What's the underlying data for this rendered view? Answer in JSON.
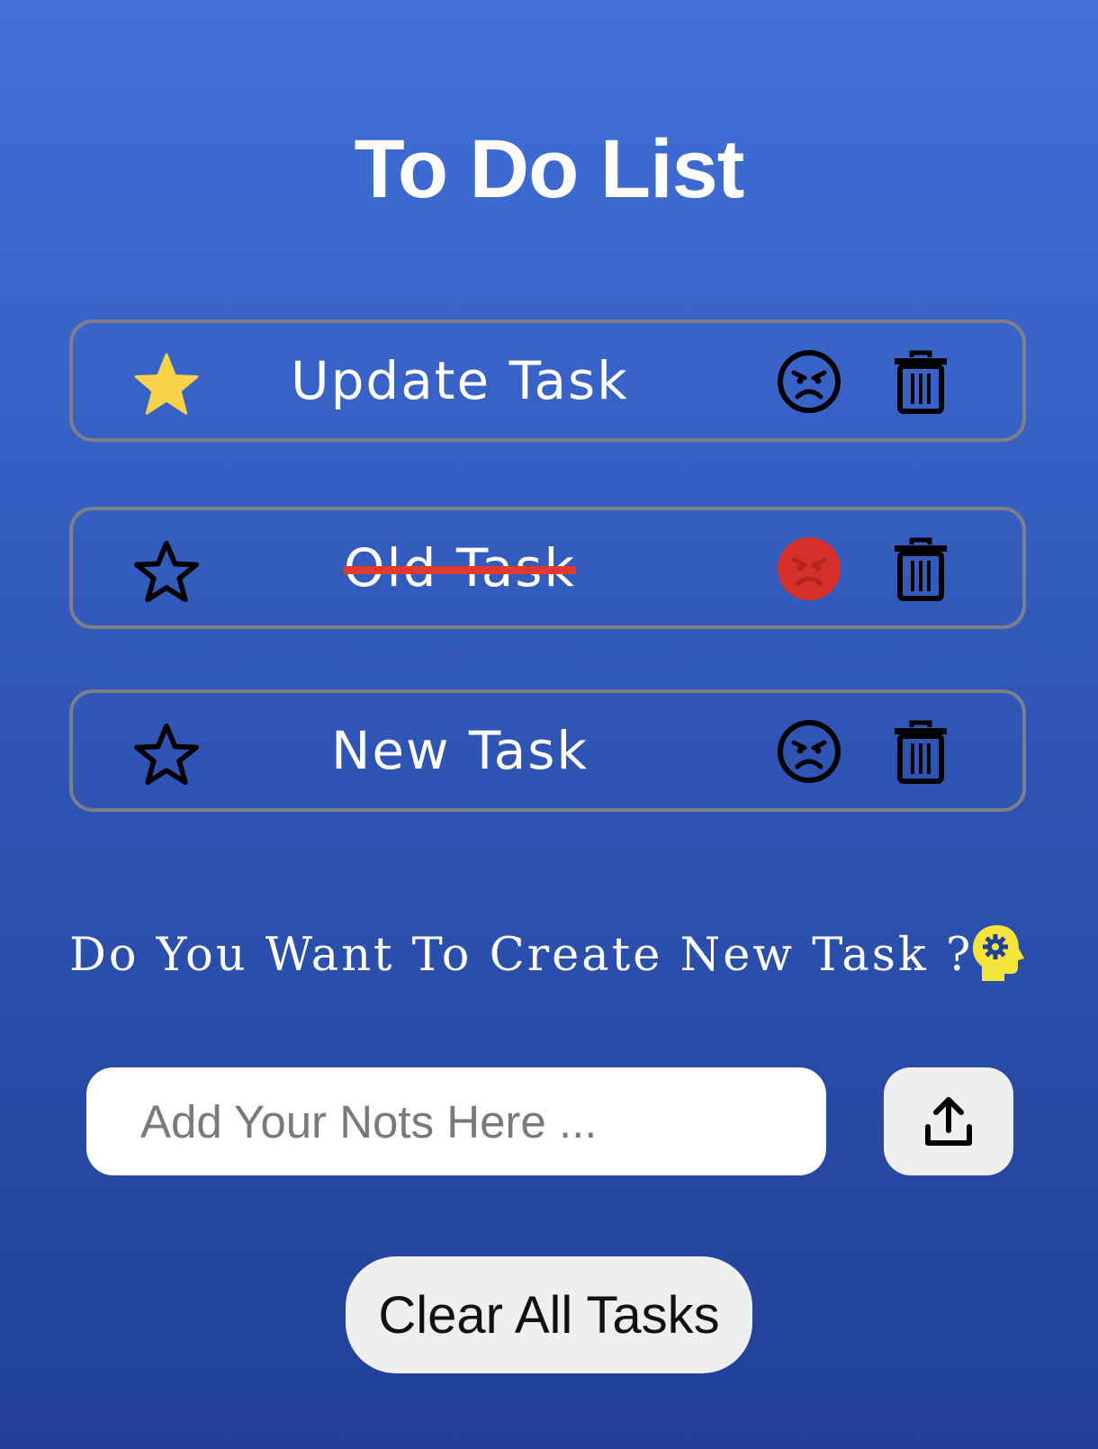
{
  "title": "To Do List",
  "tasks": [
    {
      "label": "Update Task",
      "starred": true,
      "completed": false
    },
    {
      "label": "Old Task",
      "starred": false,
      "completed": true
    },
    {
      "label": "New Task",
      "starred": false,
      "completed": false
    }
  ],
  "question": "Do You Want To Create New Task ?",
  "note_input": {
    "placeholder": "Add Your Nots Here ...",
    "value": ""
  },
  "clear_button": "Clear All Tasks",
  "colors": {
    "star_filled": "#f8d247",
    "angry_active": "#d6302a",
    "strike": "#e03a2f",
    "head_icon": "#f5e53b"
  },
  "icons": {
    "star": "star-icon",
    "face": "angry-face-icon",
    "trash": "trash-icon",
    "upload": "upload-icon",
    "head": "head-gear-icon"
  }
}
